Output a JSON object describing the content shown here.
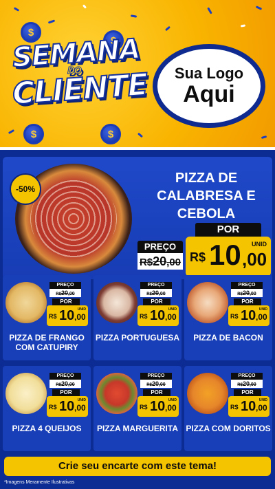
{
  "header": {
    "title_line1": "SEMANA",
    "title_line2": "DO",
    "title_line3": "CLIENTE",
    "logo_line1": "Sua Logo",
    "logo_line2": "Aqui",
    "coin_symbol": "$"
  },
  "featured": {
    "discount": "-50%",
    "name": "PIZZA DE CALABRESA E CEBOLA",
    "preco_label": "PREÇO",
    "old_currency": "R$",
    "old_int": "20",
    "old_cents": ",00",
    "por_label": "POR",
    "currency": "R$",
    "price_int": "10",
    "price_cents": ",00",
    "unit": "UNID"
  },
  "grid": [
    {
      "name": "PIZZA DE FRANGO COM CATUPIRY",
      "preco_label": "PREÇO",
      "old_currency": "R$",
      "old_int": "20",
      "old_cents": ",00",
      "por_label": "POR",
      "currency": "R$",
      "price_int": "10",
      "price_cents": ",00",
      "unit": "UNID"
    },
    {
      "name": "PIZZA PORTUGUESA",
      "preco_label": "PREÇO",
      "old_currency": "R$",
      "old_int": "20",
      "old_cents": ",00",
      "por_label": "POR",
      "currency": "R$",
      "price_int": "10",
      "price_cents": ",00",
      "unit": "UNID"
    },
    {
      "name": "PIZZA DE BACON",
      "preco_label": "PREÇO",
      "old_currency": "R$",
      "old_int": "20",
      "old_cents": ",00",
      "por_label": "POR",
      "currency": "R$",
      "price_int": "10",
      "price_cents": ",00",
      "unit": "UNID"
    },
    {
      "name": "PIZZA 4 QUEIJOS",
      "preco_label": "PREÇO",
      "old_currency": "R$",
      "old_int": "20",
      "old_cents": ",00",
      "por_label": "POR",
      "currency": "R$",
      "price_int": "10",
      "price_cents": ",00",
      "unit": "UNID"
    },
    {
      "name": "PIZZA MARGUERITA",
      "preco_label": "PREÇO",
      "old_currency": "R$",
      "old_int": "20",
      "old_cents": ",00",
      "por_label": "POR",
      "currency": "R$",
      "price_int": "10",
      "price_cents": ",00",
      "unit": "UNID"
    },
    {
      "name": "PIZZA COM DORITOS",
      "preco_label": "PREÇO",
      "old_currency": "R$",
      "old_int": "20",
      "old_cents": ",00",
      "por_label": "POR",
      "currency": "R$",
      "price_int": "10",
      "price_cents": ",00",
      "unit": "UNID"
    }
  ],
  "footer": {
    "cta": "Crie seu encarte com este tema!",
    "disclaimer": "*Imagens Meramente Ilustrativas"
  },
  "colors": {
    "blue": "#0c2c93",
    "yellow": "#f5c400",
    "orange": "#f29a00"
  }
}
